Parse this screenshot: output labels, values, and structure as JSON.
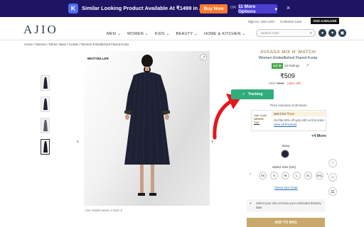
{
  "extension_banner": {
    "logo_letter": "K",
    "text": "Similar Looking Product Available At ₹1499 in Amazon",
    "buy_now": "Buy Now",
    "or": "OR",
    "more_options": "11 More Options",
    "more_options_chevron": "▾",
    "close": "×"
  },
  "header": {
    "logo": "AJIO",
    "top_links": [
      "Sign In / Join AJIO",
      "Customer Care"
    ],
    "visit_button": "Visit AJIOLUXE",
    "nav": [
      "MEN",
      "WOMEN",
      "KIDS",
      "BEAUTY",
      "HOME & KITCHEN"
    ],
    "search_placeholder": "Search AJIO",
    "icons": [
      "user-icon",
      "heart-icon",
      "bag-icon"
    ]
  },
  "breadcrumb": "Home  /  Women  /  Ethnic Wear  /  Kurtas  /  Women Embellished Flared Kurta",
  "gallery": {
    "badge": "BESTSELLER",
    "caption": "Our model wears a Size S",
    "thumbnails": [
      {
        "color": "#1f2233"
      },
      {
        "color": "#1f2233"
      },
      {
        "color": "#5b5c68"
      },
      {
        "color": "#151722"
      }
    ]
  },
  "product": {
    "brand": "AVAASA MIX N' MATCH",
    "name": "Women Embellished Flared Kurta",
    "rating": "4.2 ★",
    "rating_count": "28 Ratings",
    "price": "₹509",
    "mrp": "MRP",
    "mrp_value": "₹999",
    "discount": "(49% Off)",
    "tracking_button": "Tracking",
    "tax_note": "Price inclusive of all taxes",
    "offer": {
      "use_code_label": "Use Code",
      "code": "NEW50",
      "tc": "T&C",
      "get_it_for": "Get it for",
      "get_it_price": "₹316",
      "body": "Get flat 50% off upto 400 on first order.",
      "link": "View All Products"
    },
    "more_offers": "+4 More",
    "color_label": "Navy",
    "size_label": "Select Size (UK)",
    "sizes": [
      "XS",
      "S",
      "M",
      "L",
      "XL",
      "XXL"
    ],
    "size_chart": "Check Size Chart",
    "delivery_text": "Select your size to know your estimated delivery date.",
    "add_to_bag": "ADD TO BAG"
  },
  "colors": {
    "banner_bg": "#1d1464",
    "buy_now": "#ff7a2f",
    "tracking": "#30ad7b",
    "brand_gold": "#b19975",
    "rating_green": "#49a94a"
  }
}
